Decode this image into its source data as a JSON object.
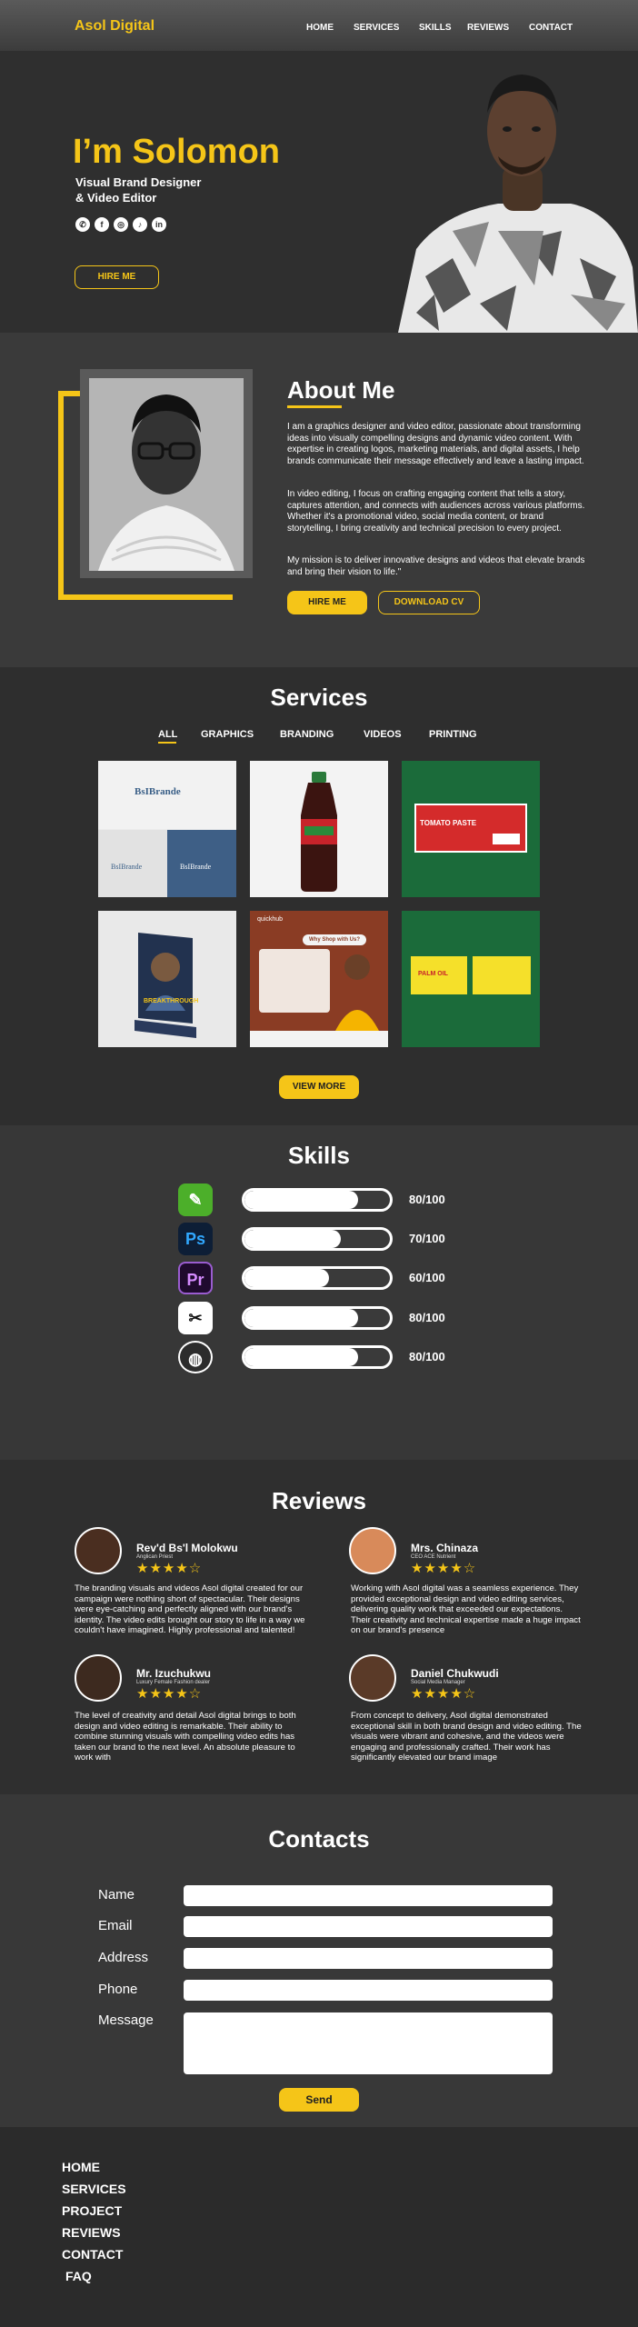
{
  "header": {
    "brand": "Asol Digital",
    "nav": [
      "HOME",
      "SERVICES",
      "SKILLS",
      "REVIEWS",
      "CONTACT"
    ]
  },
  "hero": {
    "title": "I’m Solomon",
    "subtitle_line1": "Visual Brand Designer",
    "subtitle_line2": "& Video Editor",
    "hire_label": "HIRE ME",
    "social_icons": [
      "whatsapp-icon",
      "facebook-icon",
      "instagram-icon",
      "tiktok-icon",
      "linkedin-icon"
    ]
  },
  "about": {
    "title": "About Me",
    "p1": "I am a graphics designer and video editor, passionate about transforming ideas into visually compelling designs and dynamic video content. With expertise in creating logos, marketing materials, and digital assets, I help brands communicate their message effectively and leave a lasting impact.",
    "p2": "In video editing, I focus on crafting engaging content that tells a story, captures attention, and connects with audiences across various platforms. Whether it's a promotional video, social media content, or brand storytelling, I bring creativity and technical precision to every project.",
    "p3": "My mission is to deliver innovative designs and videos that elevate brands and bring their vision to life.\"",
    "hire_label": "HIRE ME",
    "download_label": "DOWNLOAD CV"
  },
  "services": {
    "title": "Services",
    "tabs": [
      "ALL",
      "GRAPHICS",
      "BRANDING",
      "VIDEOS",
      "PRINTING"
    ],
    "active_tab": "ALL",
    "tile_texts": {
      "brand1": "BsIBrande",
      "brand2": "BsIBrande",
      "brand3": "BsIBrande",
      "tomato": "TOMATO PASTE",
      "book": "BREAKTHROUGH",
      "flyer_title": "Why Shop with Us?",
      "flyer_brand": "quickhub",
      "palm": "PALM OIL"
    },
    "view_more_label": "VIEW MORE"
  },
  "skills": {
    "title": "Skills",
    "items": [
      {
        "icon": "coreldraw-icon",
        "glyph": "✎",
        "value": "80/100",
        "level": 0.78
      },
      {
        "icon": "photoshop-icon",
        "glyph": "Ps",
        "value": "70/100",
        "level": 0.66
      },
      {
        "icon": "premiere-pro-icon",
        "glyph": "Pr",
        "value": "60/100",
        "level": 0.58
      },
      {
        "icon": "capcut-icon",
        "glyph": "✂",
        "value": "80/100",
        "level": 0.78
      },
      {
        "icon": "obs-icon",
        "glyph": "◍",
        "value": "80/100",
        "level": 0.78
      }
    ]
  },
  "reviews": {
    "title": "Reviews",
    "items": [
      {
        "name": "Rev'd Bs'l Molokwu",
        "role": "Anglican Priest",
        "stars": "★★★★☆",
        "text": "The branding visuals and videos Asol digital created for our campaign were nothing short of spectacular. Their designs were eye-catching and perfectly aligned with our brand's identity. The video edits brought our story to life in a way we couldn't have imagined. Highly professional and talented!"
      },
      {
        "name": "Mrs. Chinaza",
        "role": "CEO ACE Nutrient",
        "stars": "★★★★☆",
        "text": "Working with Asol digital was a seamless experience. They provided exceptional design and video editing services, delivering quality work that exceeded our expectations. Their creativity and technical expertise made a huge impact on our brand's presence"
      },
      {
        "name": "Mr. Izuchukwu",
        "role": "Luxury Female Fashion dealer",
        "stars": "★★★★☆",
        "text": "The level of creativity and detail Asol digital brings to both design and video editing is remarkable. Their ability to combine stunning visuals with compelling video edits has taken our brand to the next level. An absolute pleasure to work with"
      },
      {
        "name": "Daniel Chukwudi",
        "role": "Social Media Manager",
        "stars": "★★★★☆",
        "text": "From concept to delivery, Asol digital demonstrated exceptional skill in both brand design and video editing. The visuals were vibrant and cohesive, and the videos were engaging and professionally crafted. Their work has significantly elevated our brand image"
      }
    ]
  },
  "contacts": {
    "title": "Contacts",
    "fields": [
      "Name",
      "Email",
      "Address",
      "Phone",
      "Message"
    ],
    "send_label": "Send"
  },
  "footer": {
    "links": [
      "HOME",
      "SERVICES",
      "PROJECT",
      "REVIEWS",
      "CONTACT",
      "FAQ"
    ]
  },
  "colors": {
    "accent": "#f5c518",
    "background": "#333333",
    "tile_green": "#1b6b3a"
  }
}
